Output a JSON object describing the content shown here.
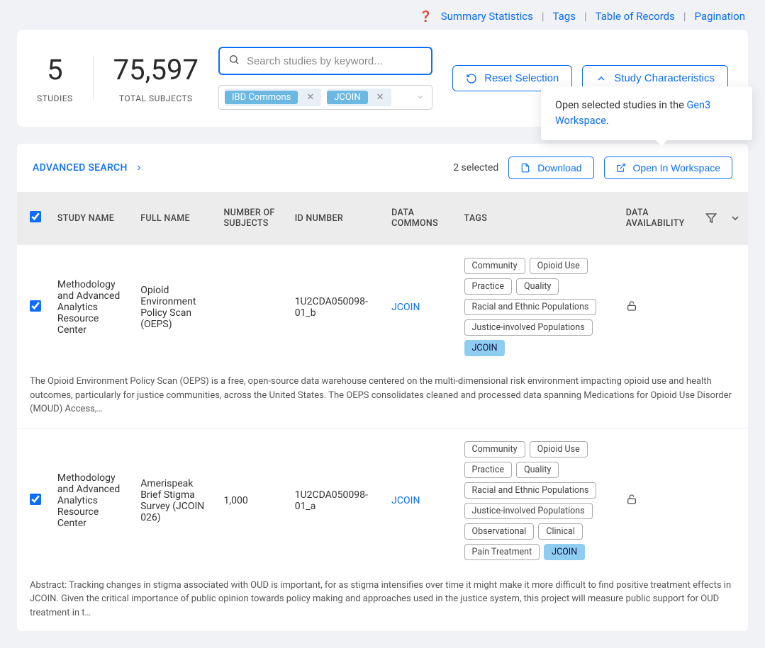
{
  "top_nav": {
    "links": [
      "Summary Statistics",
      "Tags",
      "Table of Records",
      "Pagination"
    ]
  },
  "stats": {
    "studies_val": "5",
    "studies_lbl": "STUDIES",
    "subjects_val": "75,597",
    "subjects_lbl": "TOTAL SUBJECTS"
  },
  "search": {
    "placeholder": "Search studies by keyword..."
  },
  "filter_tags": [
    "IBD Commons",
    "JCOIN"
  ],
  "actions": {
    "reset": "Reset Selection",
    "characteristics": "Study Characteristics"
  },
  "popover": {
    "prefix": "Open selected studies in the ",
    "link": "Gen3 Workspace",
    "suffix": "."
  },
  "toolbar": {
    "adv_search": "ADVANCED SEARCH",
    "selected": "2 selected",
    "download": "Download",
    "open_ws": "Open In Workspace"
  },
  "columns": {
    "study": "STUDY NAME",
    "full": "FULL NAME",
    "num": "NUMBER OF SUBJECTS",
    "id": "ID NUMBER",
    "commons": "DATA COMMONS",
    "tags": "TAGS",
    "avail": "DATA AVAILABILITY"
  },
  "rows": [
    {
      "study": "Methodology and Advanced Analytics Resource Center",
      "full": "Opioid Environment Policy Scan (OEPS)",
      "num": "",
      "id": "1U2CDA050098-01_b",
      "commons": "JCOIN",
      "tags": [
        "Community",
        "Opioid Use",
        "Practice",
        "Quality",
        "Racial and Ethnic Populations",
        "Justice-involved Populations"
      ],
      "tags_blue": [
        "JCOIN"
      ],
      "desc": "The Opioid Environment Policy Scan (OEPS) is a free, open-source data warehouse centered on the multi-dimensional risk environment impacting opioid use and health outcomes, particularly for justice communities, across the United States. The OEPS consolidates cleaned and processed data spanning Medications for Opioid Use Disorder (MOUD) Access,…"
    },
    {
      "study": "Methodology and Advanced Analytics Resource Center",
      "full": "Amerispeak Brief Stigma Survey (JCOIN 026)",
      "num": "1,000",
      "id": "1U2CDA050098-01_a",
      "commons": "JCOIN",
      "tags": [
        "Community",
        "Opioid Use",
        "Practice",
        "Quality",
        "Racial and Ethnic Populations",
        "Justice-involved Populations",
        "Observational",
        "Clinical",
        "Pain Treatment"
      ],
      "tags_blue": [
        "JCOIN"
      ],
      "desc": "Abstract: Tracking changes in stigma associated with OUD is important, for as stigma intensifies over time it might make it more difficult to find positive treatment effects in JCOIN. Given the critical importance of public opinion towards policy making and approaches used in the justice system, this project will measure public support for OUD treatment in t…"
    }
  ]
}
